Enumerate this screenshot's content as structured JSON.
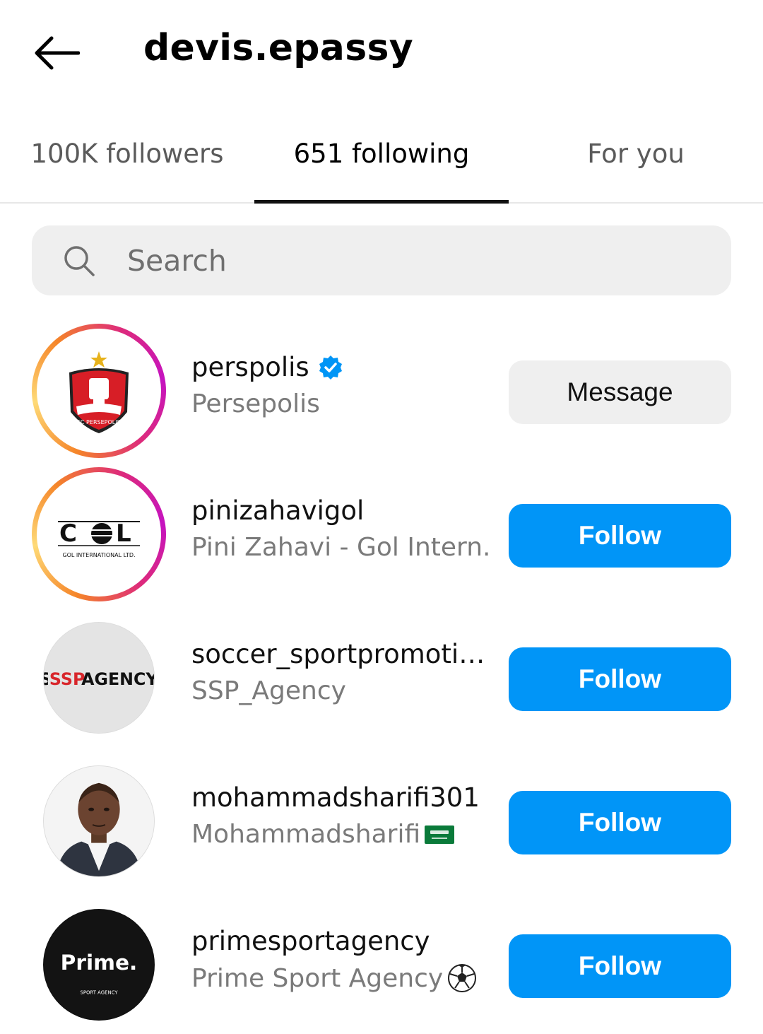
{
  "header": {
    "title": "devis.epassy",
    "back_icon": "arrow-left-icon"
  },
  "tabs": [
    {
      "label": "100K followers",
      "active": false
    },
    {
      "label": "651 following",
      "active": true
    },
    {
      "label": "For you",
      "active": false
    }
  ],
  "search": {
    "placeholder": "Search",
    "value": "",
    "icon": "search-icon"
  },
  "list": [
    {
      "username": "perspolis",
      "full_name": "Persepolis",
      "verified": true,
      "button": "Message",
      "has_story": true,
      "avatar_text": "FC PERSEPOLIS",
      "avatar_icon": "persepolis-logo"
    },
    {
      "username": "pinizahavigol",
      "full_name": "Pini Zahavi - Gol Intern...",
      "verified": false,
      "button": "Follow",
      "has_story": true,
      "avatar_text": "GOL INTERNATIONAL LTD.",
      "avatar_icon": "gol-international-logo"
    },
    {
      "username": "soccer_sportpromotio...",
      "full_name": "SSP_Agency",
      "verified": false,
      "button": "Follow",
      "has_story": false,
      "avatar_text": "SSP AGENCY",
      "avatar_icon": "ssp-agency-logo"
    },
    {
      "username": "mohammadsharifi301",
      "full_name": "Mohammadsharifi",
      "full_name_suffix_icon": "saudi-flag-icon",
      "verified": false,
      "button": "Follow",
      "has_story": false,
      "avatar_icon": "person-photo"
    },
    {
      "username": "primesportagency",
      "full_name": "Prime Sport Agency",
      "full_name_suffix_icon": "soccer-ball-icon",
      "verified": false,
      "button": "Follow",
      "has_story": false,
      "avatar_text": "Prime.",
      "avatar_subtext": "SPORT AGENCY",
      "avatar_icon": "prime-logo"
    }
  ],
  "colors": {
    "follow_button": "#0195f7",
    "message_button": "#efefef",
    "verified_badge": "#0095f6",
    "tab_indicator": "#111111"
  }
}
